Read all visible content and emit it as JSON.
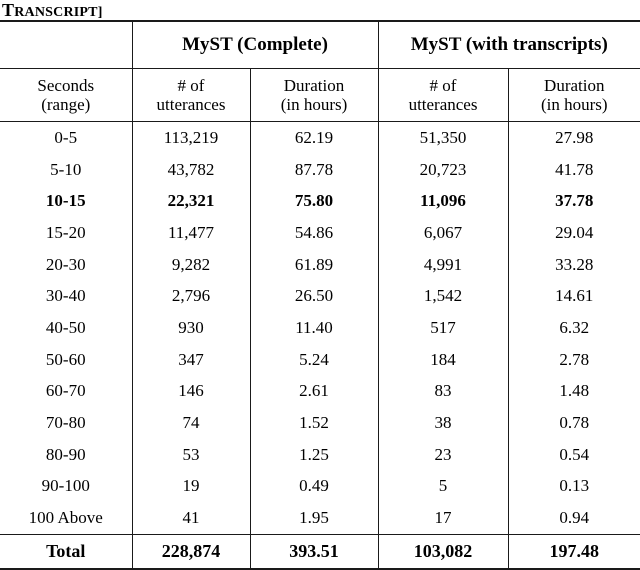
{
  "caption": {
    "tail_first": "T",
    "tail_rest": "RANSCRIPT]",
    "full_text": "TRANSCRIPT]"
  },
  "table": {
    "group_headers": [
      {
        "label": "",
        "span": 1
      },
      {
        "label": "MyST (Complete)",
        "span": 2
      },
      {
        "label": "MyST (with transcripts)",
        "span": 2
      }
    ],
    "column_headers": [
      {
        "line1": "Seconds",
        "line2": "(range)"
      },
      {
        "line1": "# of",
        "line2": "utterances"
      },
      {
        "line1": "Duration",
        "line2": "(in hours)"
      },
      {
        "line1": "# of",
        "line2": "utterances"
      },
      {
        "line1": "Duration",
        "line2": "(in hours)"
      }
    ],
    "rows": [
      {
        "range": "0-5",
        "complete_utterances": "113,219",
        "complete_duration": "62.19",
        "transcripts_utterances": "51,350",
        "transcripts_duration": "27.98",
        "bold": false
      },
      {
        "range": "5-10",
        "complete_utterances": "43,782",
        "complete_duration": "87.78",
        "transcripts_utterances": "20,723",
        "transcripts_duration": "41.78",
        "bold": false
      },
      {
        "range": "10-15",
        "complete_utterances": "22,321",
        "complete_duration": "75.80",
        "transcripts_utterances": "11,096",
        "transcripts_duration": "37.78",
        "bold": true
      },
      {
        "range": "15-20",
        "complete_utterances": "11,477",
        "complete_duration": "54.86",
        "transcripts_utterances": "6,067",
        "transcripts_duration": "29.04",
        "bold": false
      },
      {
        "range": "20-30",
        "complete_utterances": "9,282",
        "complete_duration": "61.89",
        "transcripts_utterances": "4,991",
        "transcripts_duration": "33.28",
        "bold": false
      },
      {
        "range": "30-40",
        "complete_utterances": "2,796",
        "complete_duration": "26.50",
        "transcripts_utterances": "1,542",
        "transcripts_duration": "14.61",
        "bold": false
      },
      {
        "range": "40-50",
        "complete_utterances": "930",
        "complete_duration": "11.40",
        "transcripts_utterances": "517",
        "transcripts_duration": "6.32",
        "bold": false
      },
      {
        "range": "50-60",
        "complete_utterances": "347",
        "complete_duration": "5.24",
        "transcripts_utterances": "184",
        "transcripts_duration": "2.78",
        "bold": false
      },
      {
        "range": "60-70",
        "complete_utterances": "146",
        "complete_duration": "2.61",
        "transcripts_utterances": "83",
        "transcripts_duration": "1.48",
        "bold": false
      },
      {
        "range": "70-80",
        "complete_utterances": "74",
        "complete_duration": "1.52",
        "transcripts_utterances": "38",
        "transcripts_duration": "0.78",
        "bold": false
      },
      {
        "range": "80-90",
        "complete_utterances": "53",
        "complete_duration": "1.25",
        "transcripts_utterances": "23",
        "transcripts_duration": "0.54",
        "bold": false
      },
      {
        "range": "90-100",
        "complete_utterances": "19",
        "complete_duration": "0.49",
        "transcripts_utterances": "5",
        "transcripts_duration": "0.13",
        "bold": false
      },
      {
        "range": "100 Above",
        "complete_utterances": "41",
        "complete_duration": "1.95",
        "transcripts_utterances": "17",
        "transcripts_duration": "0.94",
        "bold": false
      }
    ],
    "total_row": {
      "label": "Total",
      "complete_utterances": "228,874",
      "complete_duration": "393.51",
      "transcripts_utterances": "103,082",
      "transcripts_duration": "197.48"
    }
  },
  "colors": {
    "rule": "#1a1a1a",
    "text": "#000000",
    "background": "#ffffff"
  }
}
